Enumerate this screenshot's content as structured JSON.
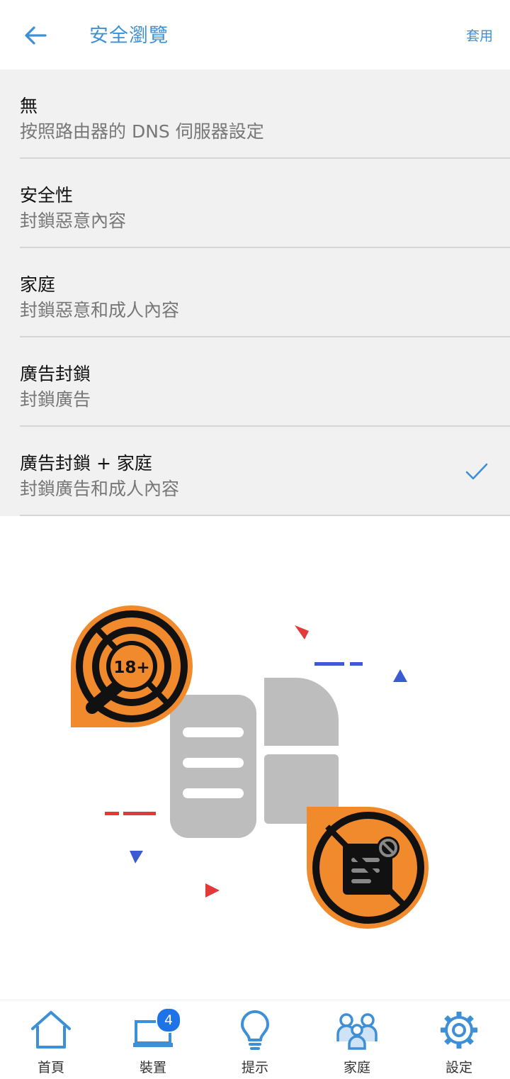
{
  "header": {
    "title": "安全瀏覽",
    "apply_label": "套用",
    "back_icon": "arrow-left-icon"
  },
  "options": [
    {
      "title": "無",
      "subtitle": "按照路由器的 DNS 伺服器設定",
      "selected": false
    },
    {
      "title": "安全性",
      "subtitle": "封鎖惡意內容",
      "selected": false
    },
    {
      "title": "家庭",
      "subtitle": "封鎖惡意和成人內容",
      "selected": false
    },
    {
      "title": "廣告封鎖",
      "subtitle": "封鎖廣告",
      "selected": false
    },
    {
      "title": "廣告封鎖 + 家庭",
      "subtitle": "封鎖廣告和成人內容",
      "selected": true
    }
  ],
  "illustration": {
    "adult_badge_text": "18+"
  },
  "bottom_nav": [
    {
      "label": "首頁",
      "icon": "home-icon"
    },
    {
      "label": "裝置",
      "icon": "laptop-icon",
      "badge": "4"
    },
    {
      "label": "提示",
      "icon": "lightbulb-icon"
    },
    {
      "label": "家庭",
      "icon": "family-icon"
    },
    {
      "label": "設定",
      "icon": "gear-icon"
    }
  ],
  "colors": {
    "accent": "#3d8fd6",
    "orange": "#f08a2c",
    "badge": "#1e73e8"
  }
}
